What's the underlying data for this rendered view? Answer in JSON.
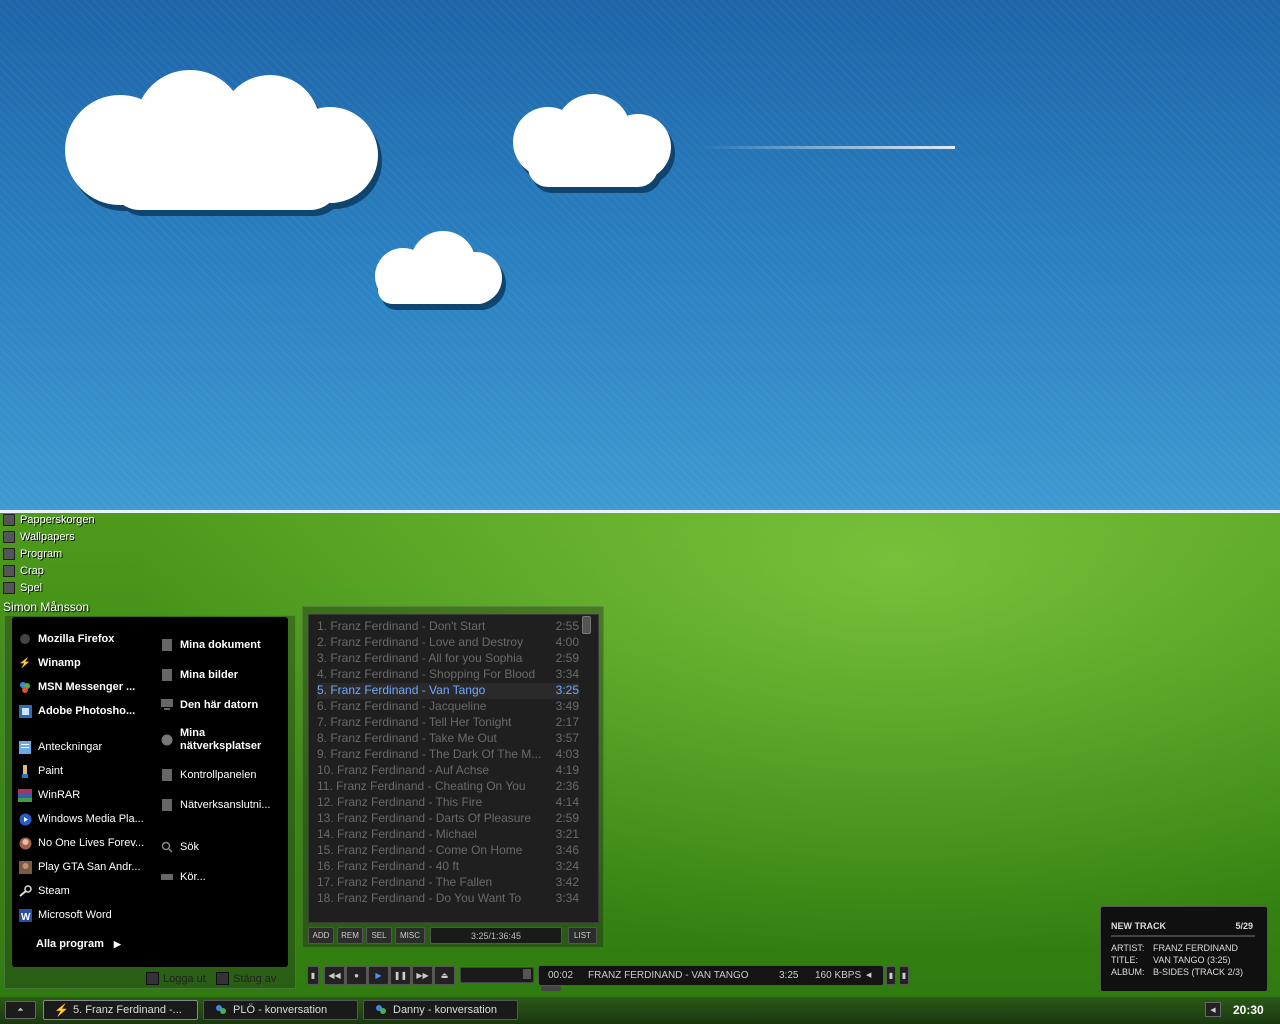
{
  "desktop_icons": [
    {
      "label": "Papperskorgen"
    },
    {
      "label": "Wallpapers"
    },
    {
      "label": "Program"
    },
    {
      "label": "Crap"
    },
    {
      "label": "Spel"
    }
  ],
  "start_menu": {
    "user_name": "Simon Månsson",
    "pinned": [
      {
        "label": "Mozilla Firefox",
        "icon": "firefox-icon"
      },
      {
        "label": "Winamp",
        "icon": "winamp-icon"
      },
      {
        "label": "MSN Messenger ...",
        "icon": "msn-icon"
      },
      {
        "label": "Adobe Photosho...",
        "icon": "photoshop-icon"
      }
    ],
    "recent": [
      {
        "label": "Anteckningar",
        "icon": "notepad-icon"
      },
      {
        "label": "Paint",
        "icon": "paint-icon"
      },
      {
        "label": "WinRAR",
        "icon": "winrar-icon"
      },
      {
        "label": "Windows Media Pla...",
        "icon": "media-player-icon"
      },
      {
        "label": "No One Lives Forev...",
        "icon": "game-icon"
      },
      {
        "label": "Play GTA San Andr...",
        "icon": "gta-icon"
      },
      {
        "label": "Steam",
        "icon": "steam-icon"
      },
      {
        "label": "Microsoft Word",
        "icon": "word-icon"
      }
    ],
    "places_bold": [
      {
        "label": "Mina dokument"
      },
      {
        "label": "Mina bilder"
      },
      {
        "label": "Den här datorn"
      },
      {
        "label": "Mina nätverksplatser"
      }
    ],
    "places": [
      {
        "label": "Kontrollpanelen"
      },
      {
        "label": "Nätverksanslutni..."
      },
      {
        "label": "Sök"
      },
      {
        "label": "Kör..."
      }
    ],
    "all_programs": "Alla program",
    "logout": "Logga ut",
    "shutdown": "Stäng av"
  },
  "playlist": {
    "tracks": [
      {
        "title": "1. Franz Ferdinand - Don't Start",
        "time": "2:55"
      },
      {
        "title": "2. Franz Ferdinand - Love and Destroy",
        "time": "4:00"
      },
      {
        "title": "3. Franz Ferdinand - All for you Sophia",
        "time": "2:59"
      },
      {
        "title": "4. Franz Ferdinand - Shopping For Blood",
        "time": "3:34"
      },
      {
        "title": "5. Franz Ferdinand - Van Tango",
        "time": "3:25",
        "active": true
      },
      {
        "title": "6. Franz Ferdinand - Jacqueline",
        "time": "3:49"
      },
      {
        "title": "7. Franz Ferdinand - Tell Her Tonight",
        "time": "2:17"
      },
      {
        "title": "8. Franz Ferdinand - Take Me Out",
        "time": "3:57"
      },
      {
        "title": "9. Franz Ferdinand - The Dark Of The M...",
        "time": "4:03"
      },
      {
        "title": "10. Franz Ferdinand - Auf Achse",
        "time": "4:19"
      },
      {
        "title": "11. Franz Ferdinand - Cheating On You",
        "time": "2:36"
      },
      {
        "title": "12. Franz Ferdinand - This Fire",
        "time": "4:14"
      },
      {
        "title": "13. Franz Ferdinand - Darts Of Pleasure",
        "time": "2:59"
      },
      {
        "title": "14. Franz Ferdinand - Michael",
        "time": "3:21"
      },
      {
        "title": "15. Franz Ferdinand - Come On Home",
        "time": "3:46"
      },
      {
        "title": "16. Franz Ferdinand - 40 ft",
        "time": "3:24"
      },
      {
        "title": "17. Franz Ferdinand - The Fallen",
        "time": "3:42"
      },
      {
        "title": "18. Franz Ferdinand - Do You Want To",
        "time": "3:34"
      }
    ],
    "buttons": {
      "add": "ADD",
      "rem": "REM",
      "sel": "SEL",
      "misc": "MISC",
      "list": "LIST"
    },
    "total_time": "3:25/1:36:45",
    "active_color": "#6fa8ff"
  },
  "player": {
    "elapsed": "00:02",
    "track": "FRANZ FERDINAND - VAN TANGO",
    "length": "3:25",
    "bitrate": "160 KBPS"
  },
  "notification": {
    "heading": "NEW TRACK",
    "position": "5/29",
    "artist_label": "ARTIST:",
    "artist": "FRANZ FERDINAND",
    "title_label": "TITLE:",
    "title": "VAN TANGO (3:25)",
    "album_label": "ALBUM:",
    "album": "B-SIDES (TRACK 2/3)"
  },
  "taskbar": {
    "tasks": [
      {
        "label": "5. Franz Ferdinand -...",
        "icon": "winamp-icon"
      },
      {
        "label": "PLÖ - konversation",
        "icon": "msn-icon"
      },
      {
        "label": "Danny - konversation",
        "icon": "msn-icon"
      }
    ],
    "clock": "20:30"
  }
}
